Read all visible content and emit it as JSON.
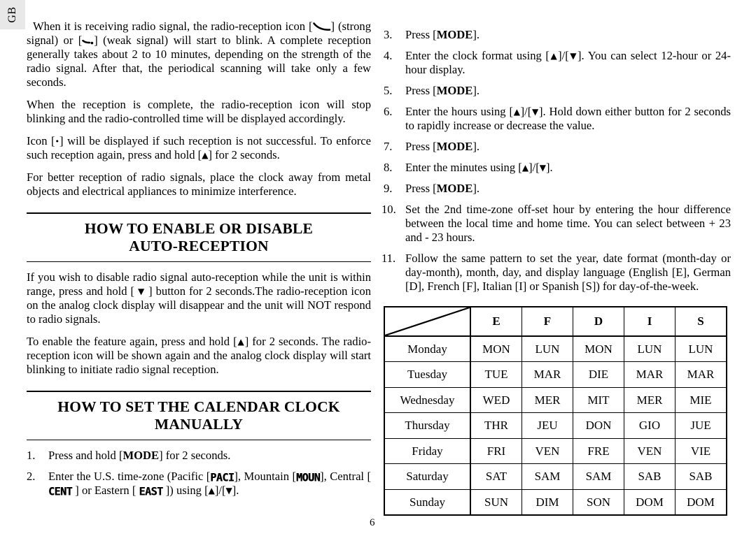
{
  "tab": {
    "label": "GB"
  },
  "page_number": "6",
  "left_column": {
    "paragraphs": [
      {
        "id": "p-receiving-signal",
        "parts": [
          {
            "t": "text",
            "v": "When it is receiving radio signal, the radio-reception icon ["
          },
          {
            "t": "icon",
            "v": "signal-strong-icon"
          },
          {
            "t": "text",
            "v": "] (strong signal) or ["
          },
          {
            "t": "icon",
            "v": "signal-weak-icon"
          },
          {
            "t": "text",
            "v": "] (weak signal) will start to blink. A complete reception generally takes about 2 to 10 minutes, depending on the strength of the radio signal. After that, the periodical scanning will take only a few seconds."
          }
        ]
      },
      {
        "id": "p-reception-complete",
        "parts": [
          {
            "t": "text",
            "v": "When the reception is complete, the radio-reception icon will stop blinking and the radio-controlled time will be displayed accordingly."
          }
        ]
      },
      {
        "id": "p-icon-unsuccessful",
        "parts": [
          {
            "t": "text",
            "v": "Icon ["
          },
          {
            "t": "dot",
            "v": "•"
          },
          {
            "t": "text",
            "v": "] will be displayed if such reception is not successful. To enforce such reception again, press and hold ["
          },
          {
            "t": "arrow",
            "v": "▲"
          },
          {
            "t": "text",
            "v": "] for 2 seconds."
          }
        ]
      },
      {
        "id": "p-better-reception",
        "parts": [
          {
            "t": "text",
            "v": "For better reception of radio signals, place the clock away from metal objects and electrical appliances to minimize interference."
          }
        ]
      }
    ],
    "section_1": {
      "heading_lines": [
        "HOW TO ENABLE OR DISABLE",
        "AUTO-RECEPTION"
      ],
      "paragraphs": [
        {
          "id": "p-disable-autoreception",
          "parts": [
            {
              "t": "text",
              "v": "If you wish to disable radio signal  auto-reception while the unit is within range, press and hold [ "
            },
            {
              "t": "arrow",
              "v": "▼"
            },
            {
              "t": "text",
              "v": " ] button for 2 seconds.The radio-reception icon on the analog clock display will disappear and the unit will NOT respond to radio signals."
            }
          ]
        },
        {
          "id": "p-enable-again",
          "parts": [
            {
              "t": "text",
              "v": "To enable the feature again, press and hold ["
            },
            {
              "t": "arrow",
              "v": "▲"
            },
            {
              "t": "text",
              "v": "] for 2 seconds. The radio-reception icon will be shown again and the analog clock display will start blinking to initiate radio signal reception."
            }
          ]
        }
      ]
    },
    "section_2": {
      "heading_lines": [
        "HOW TO SET THE CALENDAR CLOCK",
        "MANUALLY"
      ],
      "steps": [
        {
          "num": "1.",
          "parts": [
            {
              "t": "text",
              "v": "Press and hold ["
            },
            {
              "t": "bold",
              "v": "MODE"
            },
            {
              "t": "text",
              "v": "] for 2 seconds."
            }
          ]
        },
        {
          "num": "2.",
          "parts": [
            {
              "t": "text",
              "v": "Enter the U.S. time-zone (Pacific ["
            },
            {
              "t": "lcd",
              "v": "PACI"
            },
            {
              "t": "text",
              "v": "], Mountain ["
            },
            {
              "t": "lcd",
              "v": "MOUN"
            },
            {
              "t": "text",
              "v": "], Central [ "
            },
            {
              "t": "lcd",
              "v": "CENT"
            },
            {
              "t": "text",
              "v": " ] or Eastern [ "
            },
            {
              "t": "lcd",
              "v": "EAST"
            },
            {
              "t": "text",
              "v": " ]) using ["
            },
            {
              "t": "arrow",
              "v": "▲"
            },
            {
              "t": "text",
              "v": "]/["
            },
            {
              "t": "arrow",
              "v": "▼"
            },
            {
              "t": "text",
              "v": "]."
            }
          ]
        }
      ]
    }
  },
  "right_column": {
    "steps": [
      {
        "num": "3.",
        "parts": [
          {
            "t": "text",
            "v": "Press ["
          },
          {
            "t": "bold",
            "v": "MODE"
          },
          {
            "t": "text",
            "v": "]."
          }
        ]
      },
      {
        "num": "4.",
        "parts": [
          {
            "t": "text",
            "v": "Enter the clock format using ["
          },
          {
            "t": "arrow",
            "v": "▲"
          },
          {
            "t": "text",
            "v": "]/["
          },
          {
            "t": "arrow",
            "v": "▼"
          },
          {
            "t": "text",
            "v": "]. You can select 12-hour or 24-hour display."
          }
        ]
      },
      {
        "num": "5.",
        "parts": [
          {
            "t": "text",
            "v": "Press ["
          },
          {
            "t": "bold",
            "v": "MODE"
          },
          {
            "t": "text",
            "v": "]."
          }
        ]
      },
      {
        "num": "6.",
        "parts": [
          {
            "t": "text",
            "v": "Enter the hours using ["
          },
          {
            "t": "arrow",
            "v": "▲"
          },
          {
            "t": "text",
            "v": "]/["
          },
          {
            "t": "arrow",
            "v": "▼"
          },
          {
            "t": "text",
            "v": "]. Hold down either button for 2 seconds to rapidly increase or decrease the value."
          }
        ]
      },
      {
        "num": "7.",
        "parts": [
          {
            "t": "text",
            "v": "Press ["
          },
          {
            "t": "bold",
            "v": "MODE"
          },
          {
            "t": "text",
            "v": "]."
          }
        ]
      },
      {
        "num": "8.",
        "parts": [
          {
            "t": "text",
            "v": "Enter the minutes using ["
          },
          {
            "t": "arrow",
            "v": "▲"
          },
          {
            "t": "text",
            "v": "]/["
          },
          {
            "t": "arrow",
            "v": "▼"
          },
          {
            "t": "text",
            "v": "]."
          }
        ]
      },
      {
        "num": "9.",
        "parts": [
          {
            "t": "text",
            "v": "Press ["
          },
          {
            "t": "bold",
            "v": "MODE"
          },
          {
            "t": "text",
            "v": "]."
          }
        ]
      },
      {
        "num": "10.",
        "wide": true,
        "parts": [
          {
            "t": "text",
            "v": "Set the 2nd time-zone off-set hour by entering the hour difference between the local time and home time. You can select between + 23 and - 23 hours."
          }
        ]
      },
      {
        "num": "11.",
        "wide": true,
        "parts": [
          {
            "t": "text",
            "v": "Follow the same pattern to set the year, date format  (month-day or day-month), month, day, and display language (English [E], German [D], French [F], Italian [I] or Spanish [S]) for day-of-the-week."
          }
        ]
      }
    ],
    "day_table": {
      "corner_label": "",
      "columns": [
        "E",
        "F",
        "D",
        "I",
        "S"
      ],
      "rows": [
        {
          "day": "Monday",
          "values": [
            "MON",
            "LUN",
            "MON",
            "LUN",
            "LUN"
          ]
        },
        {
          "day": "Tuesday",
          "values": [
            "TUE",
            "MAR",
            "DIE",
            "MAR",
            "MAR"
          ]
        },
        {
          "day": "Wednesday",
          "values": [
            "WED",
            "MER",
            "MIT",
            "MER",
            "MIE"
          ]
        },
        {
          "day": "Thursday",
          "values": [
            "THR",
            "JEU",
            "DON",
            "GIO",
            "JUE"
          ]
        },
        {
          "day": "Friday",
          "values": [
            "FRI",
            "VEN",
            "FRE",
            "VEN",
            "VIE"
          ]
        },
        {
          "day": "Saturday",
          "values": [
            "SAT",
            "SAM",
            "SAM",
            "SAB",
            "SAB"
          ]
        },
        {
          "day": "Sunday",
          "values": [
            "SUN",
            "DIM",
            "SON",
            "DOM",
            "DOM"
          ]
        }
      ]
    }
  }
}
